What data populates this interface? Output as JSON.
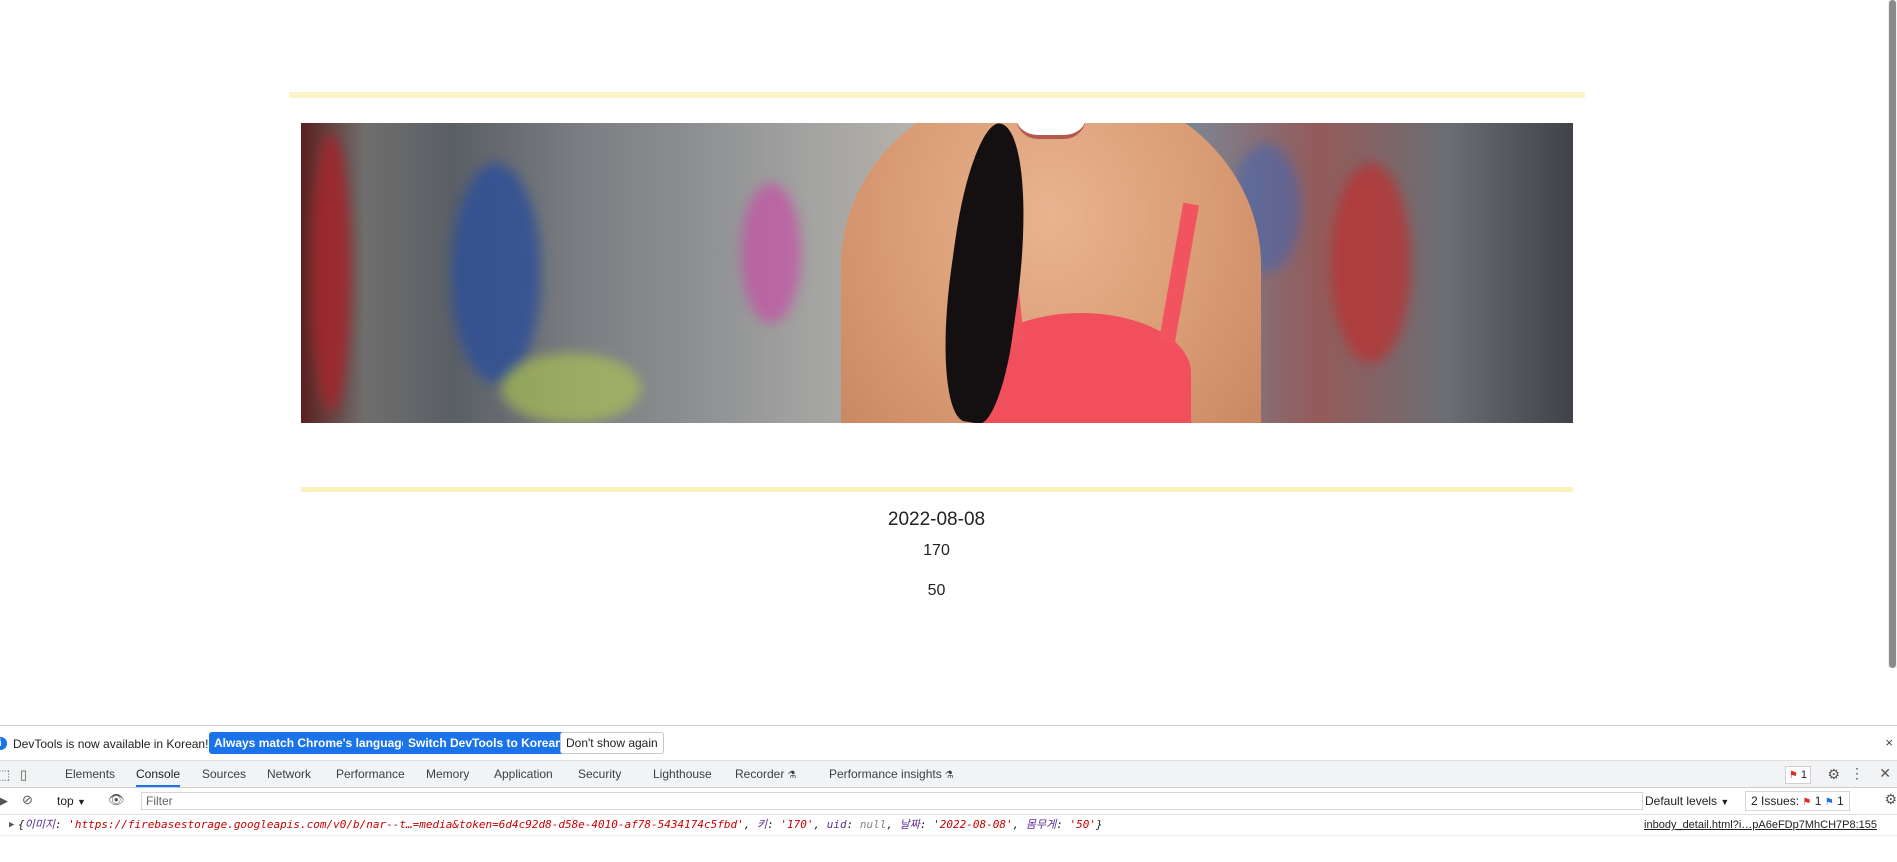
{
  "page": {
    "date": "2022-08-08",
    "height": "170",
    "weight": "50"
  },
  "devtools": {
    "infobar": {
      "message": "DevTools is now available in Korean!",
      "btn_match": "Always match Chrome's language",
      "btn_switch": "Switch DevTools to Korean",
      "btn_dismiss": "Don't show again",
      "close": "×"
    },
    "tabs": [
      "Elements",
      "Console",
      "Sources",
      "Network",
      "Performance",
      "Memory",
      "Application",
      "Security",
      "Lighthouse",
      "Recorder",
      "Performance insights"
    ],
    "error_count": "1",
    "toolbar": {
      "context": "top",
      "filter_placeholder": "Filter",
      "levels": "Default levels",
      "issues_label": "2 Issues:",
      "issues_errors": "1",
      "issues_info": "1"
    },
    "console": {
      "open_brace": "{",
      "k_image": "이미지",
      "v_image": "'https://firebasestorage.googleapis.com/v0/b/nar--t…=media&token=6d4c92d8-d58e-4010-af78-5434174c5fbd'",
      "k_height": "키",
      "v_height": "'170'",
      "k_uid": "uid",
      "v_uid": "null",
      "k_date": "날짜",
      "v_date": "'2022-08-08'",
      "k_weight": "몸무게",
      "v_weight": "'50'",
      "close_brace": "}",
      "source": "inbody_detail.html?i…pA6eFDp7MhCH7P8:155"
    },
    "accent_color": "#1a73e8"
  }
}
